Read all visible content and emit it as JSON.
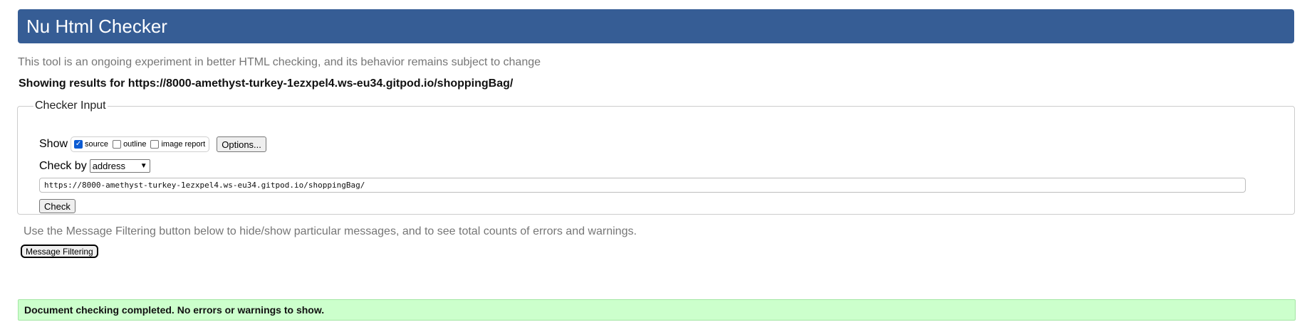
{
  "header": {
    "title": "Nu Html Checker"
  },
  "tagline": "This tool is an ongoing experiment in better HTML checking, and its behavior remains subject to change",
  "showing_results": "Showing results for https://8000-amethyst-turkey-1ezxpel4.ws-eu34.gitpod.io/shoppingBag/",
  "checker_input": {
    "legend": "Checker Input",
    "show_label": "Show",
    "options": [
      {
        "label": "source",
        "checked": true
      },
      {
        "label": "outline",
        "checked": false
      },
      {
        "label": "image report",
        "checked": false
      }
    ],
    "options_button": "Options...",
    "check_by_label": "Check by",
    "check_by_value": "address",
    "url_value": "https://8000-amethyst-turkey-1ezxpel4.ws-eu34.gitpod.io/shoppingBag/",
    "check_button": "Check"
  },
  "filter_note": "Use the Message Filtering button below to hide/show particular messages, and to see total counts of errors and warnings.",
  "filter_button": "Message Filtering",
  "result_message": "Document checking completed. No errors or warnings to show.",
  "colors": {
    "header_bg": "#365d95",
    "success_bg": "#ccffcc",
    "checkbox_checked": "#0b5bd3"
  }
}
